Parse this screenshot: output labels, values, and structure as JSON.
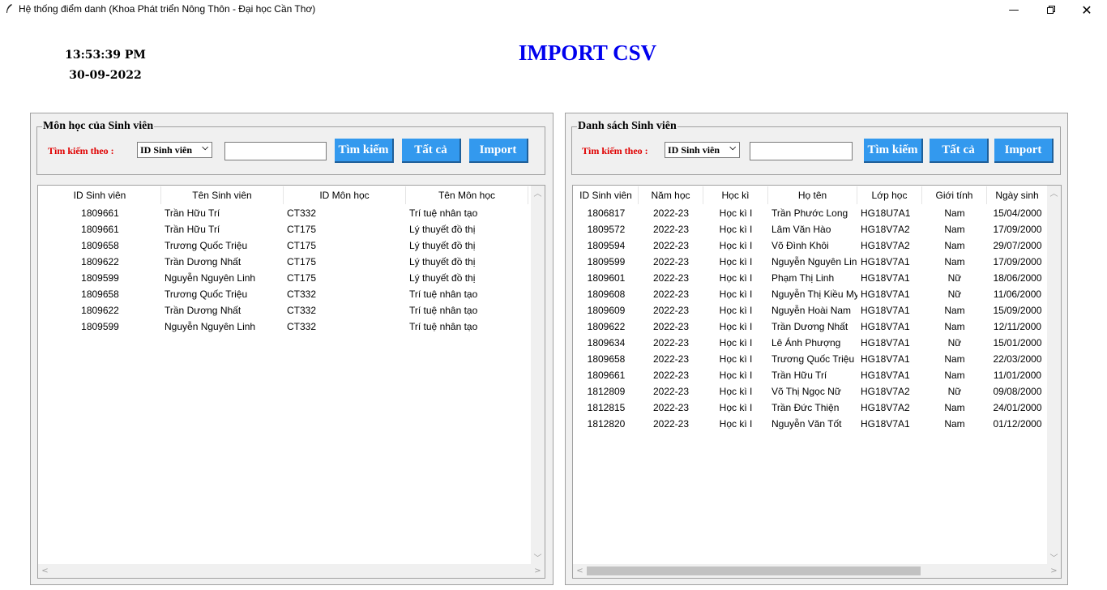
{
  "window": {
    "title": "Hệ thống điểm danh (Khoa Phát triển Nông Thôn - Đại học Cần Thơ)",
    "minimize_icon": "minimize-icon",
    "restore_icon": "restore-icon",
    "close_icon": "close-icon"
  },
  "clock": {
    "time": "13:53:39 PM",
    "date": "30-09-2022"
  },
  "page_title": "IMPORT CSV",
  "colors": {
    "title": "#0000ee",
    "search_label": "#e00000",
    "button_bg": "#3399ee",
    "button_text": "#ffffff"
  },
  "left_panel": {
    "group_title": "Môn học của Sinh viên",
    "search_label": "Tìm kiếm theo :",
    "search_by": "ID Sinh viên",
    "search_value": "",
    "buttons": {
      "search": "Tìm kiếm",
      "all": "Tất cả",
      "import": "Import"
    },
    "columns": [
      "ID Sinh viên",
      "Tên Sinh viên",
      "ID Môn học",
      "Tên Môn học"
    ],
    "rows": [
      [
        "1809661",
        "Trần Hữu Trí",
        "CT332",
        "Trí tuệ nhân tạo"
      ],
      [
        "1809661",
        "Trần Hữu Trí",
        "CT175",
        "Lý thuyết đồ thị"
      ],
      [
        "1809658",
        "Trương Quốc Triệu",
        "CT175",
        "Lý thuyết đồ thị"
      ],
      [
        "1809622",
        "Trần Dương Nhất",
        "CT175",
        "Lý thuyết đồ thị"
      ],
      [
        "1809599",
        "Nguyễn Nguyên Linh",
        "CT175",
        "Lý thuyết đồ thị"
      ],
      [
        "1809658",
        "Trương Quốc Triệu",
        "CT332",
        "Trí tuệ nhân tạo"
      ],
      [
        "1809622",
        "Trần Dương Nhất",
        "CT332",
        "Trí tuệ nhân tạo"
      ],
      [
        "1809599",
        "Nguyễn Nguyên Linh",
        "CT332",
        "Trí tuệ nhân tạo"
      ]
    ]
  },
  "right_panel": {
    "group_title": "Danh sách Sinh viên",
    "search_label": "Tìm kiếm theo :",
    "search_by": "ID Sinh viên",
    "search_value": "",
    "buttons": {
      "search": "Tìm kiếm",
      "all": "Tất cả",
      "import": "Import"
    },
    "columns": [
      "ID Sinh viên",
      "Năm học",
      "Học kì",
      "Họ tên",
      "Lớp học",
      "Giới tính",
      "Ngày sinh"
    ],
    "rows": [
      [
        "1806817",
        "2022-23",
        "Học kì I",
        "Trần Phước Long",
        "HG18U7A1",
        "Nam",
        "15/04/2000"
      ],
      [
        "1809572",
        "2022-23",
        "Học kì I",
        "Lâm Văn Hào",
        "HG18V7A2",
        "Nam",
        "17/09/2000"
      ],
      [
        "1809594",
        "2022-23",
        "Học kì I",
        "Võ Đình Khôi",
        "HG18V7A2",
        "Nam",
        "29/07/2000"
      ],
      [
        "1809599",
        "2022-23",
        "Học kì I",
        "Nguyễn Nguyên Linh",
        "HG18V7A1",
        "Nam",
        "17/09/2000"
      ],
      [
        "1809601",
        "2022-23",
        "Học kì I",
        "Phạm Thị Linh",
        "HG18V7A1",
        "Nữ",
        "18/06/2000"
      ],
      [
        "1809608",
        "2022-23",
        "Học kì I",
        "Nguyễn Thị Kiều My",
        "HG18V7A1",
        "Nữ",
        "11/06/2000"
      ],
      [
        "1809609",
        "2022-23",
        "Học kì I",
        "Nguyễn Hoài Nam",
        "HG18V7A1",
        "Nam",
        "15/09/2000"
      ],
      [
        "1809622",
        "2022-23",
        "Học kì I",
        "Trần Dương Nhất",
        "HG18V7A1",
        "Nam",
        "12/11/2000"
      ],
      [
        "1809634",
        "2022-23",
        "Học kì I",
        "Lê Ánh Phượng",
        "HG18V7A1",
        "Nữ",
        "15/01/2000"
      ],
      [
        "1809658",
        "2022-23",
        "Học kì I",
        "Trương Quốc Triệu",
        "HG18V7A1",
        "Nam",
        "22/03/2000"
      ],
      [
        "1809661",
        "2022-23",
        "Học kì I",
        "Trần Hữu Trí",
        "HG18V7A1",
        "Nam",
        "11/01/2000"
      ],
      [
        "1812809",
        "2022-23",
        "Học kì I",
        "Võ Thị Ngọc Nữ",
        "HG18V7A2",
        "Nữ",
        "09/08/2000"
      ],
      [
        "1812815",
        "2022-23",
        "Học kì I",
        "Trần Đức Thiện",
        "HG18V7A2",
        "Nam",
        "24/01/2000"
      ],
      [
        "1812820",
        "2022-23",
        "Học kì I",
        "Nguyễn Văn Tốt",
        "HG18V7A1",
        "Nam",
        "01/12/2000"
      ]
    ]
  }
}
